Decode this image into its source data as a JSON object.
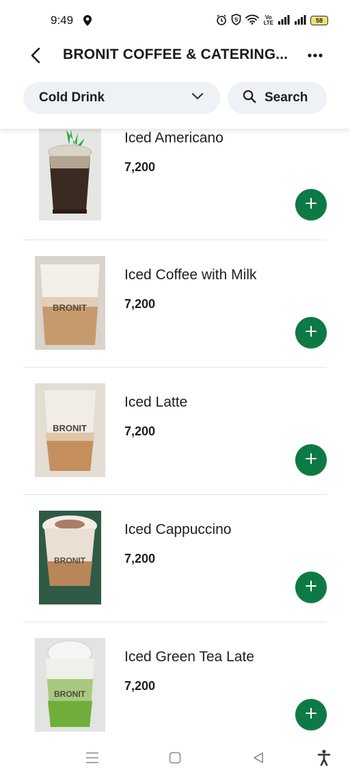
{
  "status_bar": {
    "time": "9:49",
    "battery": "58",
    "icons": [
      "location-icon",
      "alarm-icon",
      "shield-icon",
      "wifi-icon",
      "volte-icon",
      "signal-icon",
      "signal-icon",
      "battery-icon"
    ]
  },
  "header": {
    "title": "BRONIT COFFEE & CATERING...",
    "back_icon": "back-arrow-icon",
    "more_icon": "more-icon"
  },
  "filter": {
    "category": "Cold Drink",
    "search_label": "Search"
  },
  "products": [
    {
      "name": "Iced Americano",
      "price": "7,200",
      "image": "iced-americano"
    },
    {
      "name": "Iced Coffee with Milk",
      "price": "7,200",
      "image": "iced-coffee-with-milk"
    },
    {
      "name": "Iced Latte",
      "price": "7,200",
      "image": "iced-latte"
    },
    {
      "name": "Iced Cappuccino",
      "price": "7,200",
      "image": "iced-cappuccino"
    },
    {
      "name": "Iced Green Tea Late",
      "price": "7,200",
      "image": "iced-green-tea-late"
    }
  ],
  "cup_logo": "BRONIT",
  "colors": {
    "accent_green": "#0d7a45",
    "pill_background": "#eef1f5"
  },
  "nav_bar": {
    "icons": [
      "menu-icon",
      "home-icon",
      "back-icon",
      "accessibility-icon"
    ]
  }
}
